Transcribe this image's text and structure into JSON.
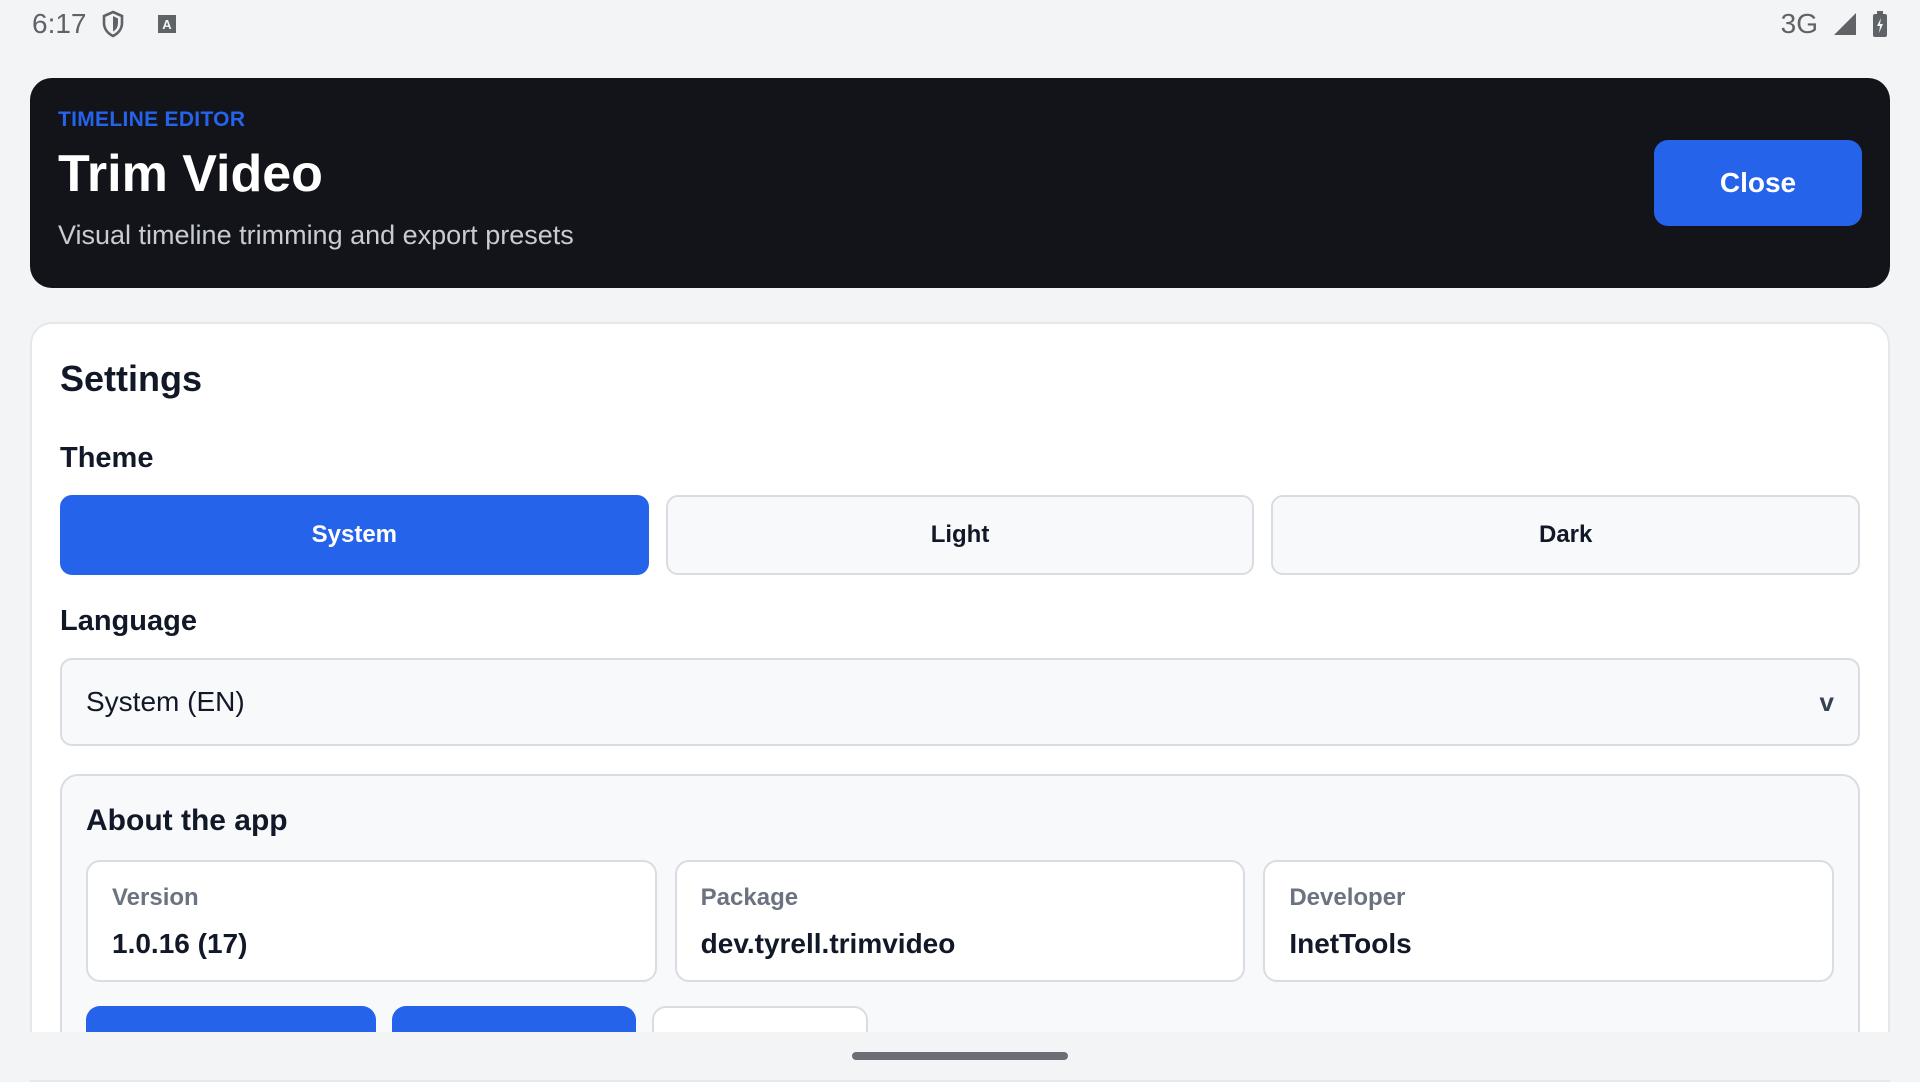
{
  "status_bar": {
    "time": "6:17",
    "network": "3G",
    "icons": [
      "shield-icon",
      "font-badge-icon",
      "signal-icon",
      "battery-charging-icon"
    ]
  },
  "header": {
    "eyebrow": "TIMELINE EDITOR",
    "title": "Trim Video",
    "subtitle": "Visual timeline trimming and export presets",
    "close_label": "Close"
  },
  "settings": {
    "title": "Settings",
    "theme": {
      "label": "Theme",
      "options": [
        "System",
        "Light",
        "Dark"
      ],
      "selected": "System"
    },
    "language": {
      "label": "Language",
      "value": "System (EN)",
      "chevron": "v"
    },
    "about": {
      "title": "About the app",
      "items": [
        {
          "key": "Version",
          "value": "1.0.16 (17)"
        },
        {
          "key": "Package",
          "value": "dev.tyrell.trimvideo"
        },
        {
          "key": "Developer",
          "value": "InetTools"
        }
      ]
    }
  },
  "colors": {
    "accent": "#2563eb",
    "header_bg": "#12141a",
    "page_bg": "#f3f4f6"
  }
}
